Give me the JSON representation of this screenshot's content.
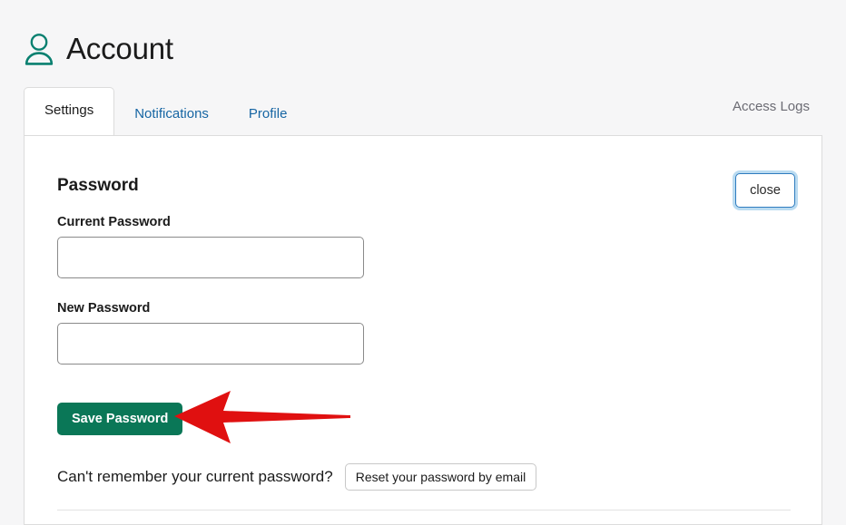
{
  "page": {
    "title": "Account",
    "icon": "user-icon",
    "background_color": "#f6f6f7"
  },
  "tabs": {
    "items": [
      {
        "label": "Settings",
        "active": true
      },
      {
        "label": "Notifications",
        "active": false
      },
      {
        "label": "Profile",
        "active": false
      }
    ],
    "right_link": "Access Logs",
    "link_color": "#1665a3"
  },
  "password_panel": {
    "heading": "Password",
    "close_label": "close",
    "close_border_color": "#2f7cbf",
    "fields": [
      {
        "label": "Current Password",
        "value": "",
        "placeholder": ""
      },
      {
        "label": "New Password",
        "value": "",
        "placeholder": ""
      }
    ],
    "save_label": "Save Password",
    "save_color": "#0a7757",
    "reset_question": "Can't remember your current password?",
    "reset_label": "Reset your password by email"
  },
  "annotation": {
    "type": "arrow",
    "color": "#e01010",
    "direction": "left",
    "points_to": "Save Password"
  }
}
